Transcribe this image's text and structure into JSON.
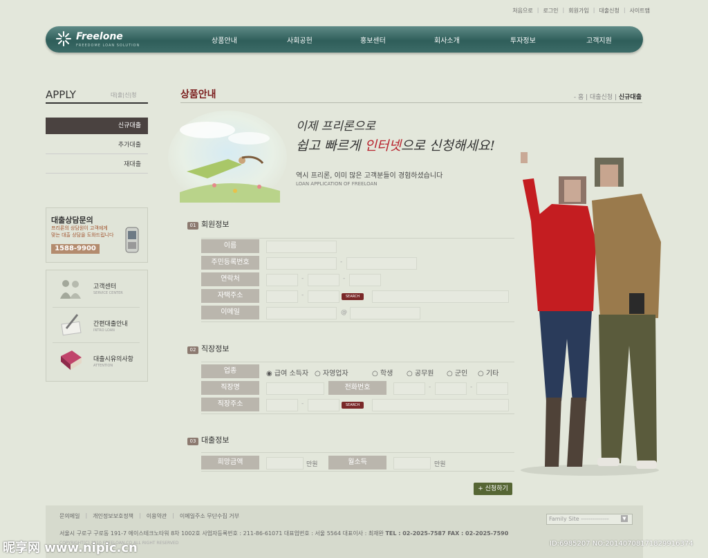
{
  "util_links": [
    "처음으로",
    "로그인",
    "회원가입",
    "대출신청",
    "사이트맵"
  ],
  "logo": {
    "name": "Freelone",
    "sub": "FREEDOME LOAN SOLUTION"
  },
  "nav": [
    "상품안내",
    "사회공헌",
    "홍보센터",
    "회사소개",
    "투자정보",
    "고객지원"
  ],
  "sidebar": {
    "title": "APPLY",
    "subtitle": "대|출|신|청",
    "items": [
      "신규대출",
      "추가대출",
      "재대출"
    ],
    "consult": {
      "title": "대출상담문의",
      "desc1": "프리론의 상담원이 고객에게",
      "desc2": "맞는 대출 상담을 도와드립니다",
      "phone": "1588-9900"
    },
    "services": [
      {
        "label": "고객센터",
        "sub": "SERVICE CENTER"
      },
      {
        "label": "간편대출안내",
        "sub": "INTRO LOAN"
      },
      {
        "label": "대출시유의사항",
        "sub": "ATTENTION"
      }
    ]
  },
  "main": {
    "title": "상품안내",
    "breadcrumb": {
      "home": "홈",
      "mid": "대출신청",
      "current": "신규대출"
    },
    "hero": {
      "line1": "이제 프리론으로",
      "line2a": "쉽고 빠르게 ",
      "line2b": "인터넷",
      "line2c": "으로 신청해세요!",
      "line3": "역시 프리론, 이미 많은 고객분들이 경험하셨습니다",
      "line4": "LOAN APPLICATION OF FREELOAN"
    },
    "sec1": {
      "num": "01",
      "title": "회원정보",
      "labels": [
        "이름",
        "주민등록번호",
        "연락처",
        "자택주소",
        "이메일"
      ]
    },
    "sec2": {
      "num": "02",
      "title": "직장정보",
      "labels": [
        "업종",
        "직장명",
        "직장주소"
      ],
      "phone_label": "전화번호",
      "options": [
        "급여 소득자",
        "자영업자",
        "학생",
        "공무원",
        "군인",
        "기타"
      ]
    },
    "sec3": {
      "num": "03",
      "title": "대출정보",
      "labels": [
        "희망금액",
        "월소득"
      ],
      "unit": "만원"
    },
    "search": "SEARCH",
    "at": "@",
    "dash": "-",
    "submit": "+ 신청하기"
  },
  "footer": {
    "links": [
      "문의메일",
      "개인정보보호정책",
      "이용약관",
      "이메일주소 무단수집 거부"
    ],
    "family": "Family Site --------------",
    "address": "서울시 구로구 구로동 191-7 에이스테크노타워 8차 1002호  사업자등록번호 : 211-86-61071  대표업번호 : 서울 5564  대표이사 : 최재완",
    "tel": "TEL : 02-2025-7587   FAX : 02-2025-7590",
    "copyright": "COPYRIGHT(C) 2010 FREELOAN.CO ALL RIGHT RESERVED"
  },
  "watermark": {
    "logo": "昵享网 www.nipic.cn",
    "id": "ID:6985207 NO:20140708171829916374"
  }
}
